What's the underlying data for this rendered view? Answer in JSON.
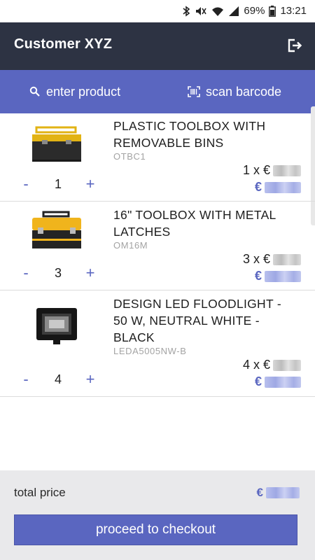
{
  "status_bar": {
    "battery": "69%",
    "time": "13:21"
  },
  "header": {
    "title": "Customer XYZ"
  },
  "actions": {
    "enter_product": "enter product",
    "scan_barcode": "scan barcode"
  },
  "currency": "€",
  "cart": {
    "items": [
      {
        "name": "PLASTIC TOOLBOX WITH REMOVABLE BINS",
        "sku": "OTBC1",
        "quantity": "1",
        "unit_qty": "1 x €"
      },
      {
        "name": "16\" TOOLBOX WITH METAL LATCHES",
        "sku": "OM16M",
        "quantity": "3",
        "unit_qty": "3 x €"
      },
      {
        "name": "DESIGN LED FLOODLIGHT - 50 W, NEUTRAL WHITE - BLACK",
        "sku": "LEDA5005NW-B",
        "quantity": "4",
        "unit_qty": "4 x €"
      }
    ]
  },
  "footer": {
    "total_label": "total price",
    "checkout_label": "proceed to checkout"
  },
  "colors": {
    "accent": "#5a66c0",
    "header_bg": "#2d3343",
    "footer_bg": "#e9e9eb"
  }
}
